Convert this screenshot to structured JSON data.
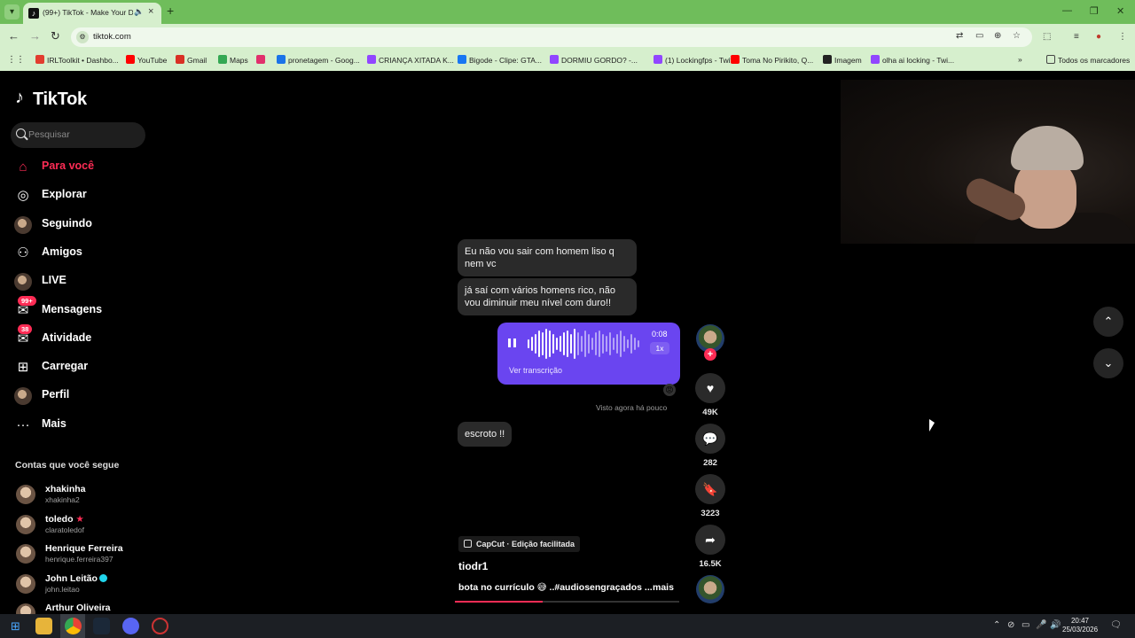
{
  "browser": {
    "tab_title": "(99+) TikTok - Make Your Day",
    "url": "tiktok.com",
    "bookmarks": [
      {
        "label": "IRLToolkit • Dashbo...",
        "color": "#e23d2f"
      },
      {
        "label": "YouTube",
        "color": "#ff0000"
      },
      {
        "label": "Gmail",
        "color": "#d93025"
      },
      {
        "label": "Maps",
        "color": "#34a853"
      },
      {
        "label": "",
        "color": "#e1306c"
      },
      {
        "label": "pronetagem - Goog...",
        "color": "#1a73e8"
      },
      {
        "label": "CRIANÇA XITADA K...",
        "color": "#9146ff"
      },
      {
        "label": "Bigode - Clipe: GTA...",
        "color": "#1877f2"
      },
      {
        "label": "DORMIU GORDO? -...",
        "color": "#9146ff"
      },
      {
        "label": "(1) Lockingfps - Twit...",
        "color": "#9146ff"
      },
      {
        "label": "Toma No Pirikito, Q...",
        "color": "#ff0000"
      },
      {
        "label": "Imagem",
        "color": "#222222"
      },
      {
        "label": "olha ai locking - Twi...",
        "color": "#9146ff"
      }
    ],
    "all_bookmarks": "Todos os marcadores"
  },
  "sidebar": {
    "logo": "TikTok",
    "search_placeholder": "Pesquisar",
    "nav": [
      {
        "label": "Para você",
        "icon": "home-icon"
      },
      {
        "label": "Explorar",
        "icon": "compass-icon"
      },
      {
        "label": "Seguindo",
        "icon": "following-avatar"
      },
      {
        "label": "Amigos",
        "icon": "friends-icon"
      },
      {
        "label": "LIVE",
        "icon": "live-avatar"
      },
      {
        "label": "Mensagens",
        "icon": "messages-icon",
        "badge": "99+"
      },
      {
        "label": "Atividade",
        "icon": "activity-icon",
        "badge": "38"
      },
      {
        "label": "Carregar",
        "icon": "upload-icon"
      },
      {
        "label": "Perfil",
        "icon": "profile-avatar"
      },
      {
        "label": "Mais",
        "icon": "more-icon"
      }
    ],
    "following_title": "Contas que você segue",
    "accounts": [
      {
        "name": "xhakinha",
        "user": "xhakinha2"
      },
      {
        "name": "toledo",
        "user": "claratoledof"
      },
      {
        "name": "Henrique Ferreira",
        "user": "henrique.ferreira397"
      },
      {
        "name": "John Leitão",
        "user": "john.leitao"
      },
      {
        "name": "Arthur Oliveira",
        "user": ""
      }
    ]
  },
  "video": {
    "msg1": "Eu não vou sair com homem liso q nem vc",
    "msg2": "já saí com vários homens rico, não vou diminuir meu nível com duro!!",
    "audio_time": "0:08",
    "audio_speed": "1x",
    "transcript_link": "Ver transcrição",
    "seen": "Visto agora há pouco",
    "msg3": "escroto !!",
    "capcut": "CapCut · Edição facilitada",
    "author": "tiodr1",
    "description": "bota no currículo 😅 ..#audiosengraçados ...",
    "more": "mais",
    "progress": 0.39,
    "likes": "49K",
    "comments": "282",
    "saves": "3223",
    "shares": "16.5K"
  },
  "taskbar": {
    "time": "20:47",
    "date": "25/03/2026"
  }
}
